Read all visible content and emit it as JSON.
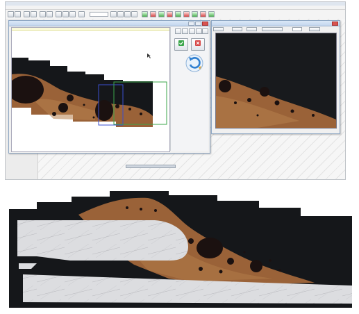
{
  "app": {
    "menu_items": [
      "",
      "",
      "",
      "",
      "",
      "",
      "",
      "",
      "",
      "",
      ""
    ],
    "zoom_combo_value": ""
  },
  "capture_window": {
    "title": "",
    "panel": {
      "top_label": "",
      "confirm_label": "",
      "cancel_label": "",
      "rotate_label": "",
      "info_lines": [
        "",
        "",
        "",
        ""
      ]
    }
  },
  "preview_window": {
    "title": "",
    "buttons": [
      "",
      "",
      "",
      "",
      ""
    ],
    "select_value": ""
  },
  "colors": {
    "tissue": "#9a6238",
    "tissue_light": "#b8824e",
    "background_dark": "#15171a",
    "bone_white": "#dcdde0",
    "selection_blue": "#3b4fd0",
    "selection_green": "#3aa64a",
    "title_bar": "#c3d6ee"
  },
  "icons": [
    "pan-tool-icon",
    "zoom-in-icon",
    "zoom-out-icon",
    "fit-icon",
    "confirm-check-icon",
    "cancel-x-icon",
    "rotate-icon"
  ]
}
